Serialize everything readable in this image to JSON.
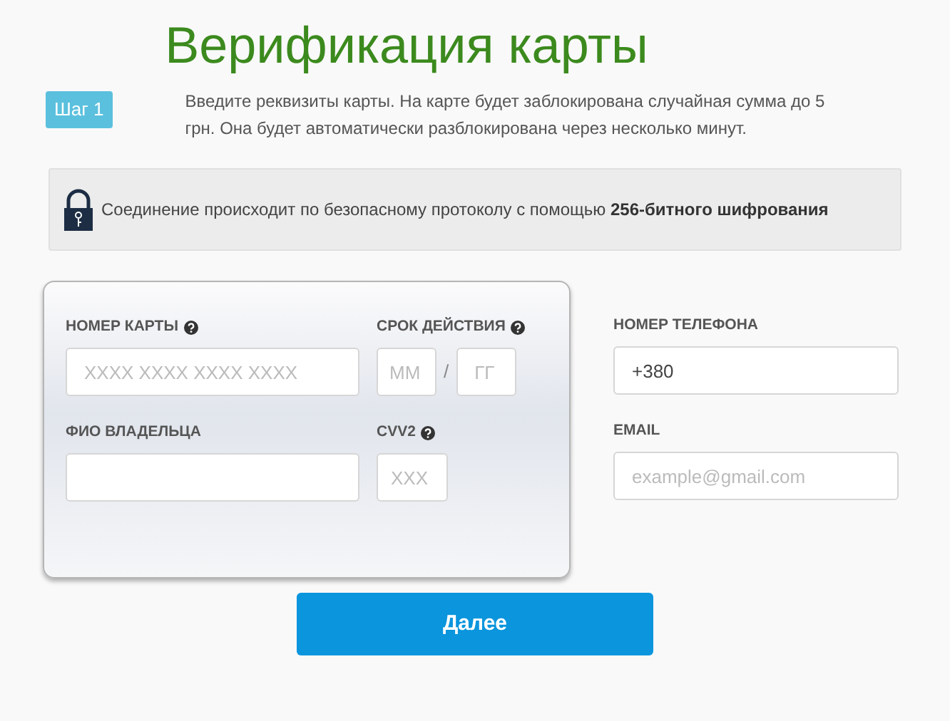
{
  "title": "Верификация карты",
  "step": {
    "badge": "Шаг 1",
    "text": "Введите реквизиты карты. На карте будет заблокирована случайная сумма до 5 грн. Она будет автоматически разблокирована через несколько минут."
  },
  "security_notice": "Соединение происходит по безопасному протоколу с помощью **256-битного шифрования**",
  "card_form": {
    "card_number": {
      "label": "НОМЕР КАРТЫ",
      "help": true,
      "placeholder": "XXXX XXXX XXXX XXXX"
    },
    "expiry": {
      "label": "СРОК ДЕЙСТВИЯ",
      "help": true,
      "month_placeholder": "ММ",
      "separator": "/",
      "year_placeholder": "ГГ"
    },
    "holder_name": {
      "label": "ФИО ВЛАДЕЛЬЦА",
      "help": false
    },
    "cvv": {
      "label": "CVV2",
      "help": true,
      "placeholder": "XXX"
    }
  },
  "contact_form": [
    {
      "label": "НОМЕР ТЕЛЕФОНА",
      "value": "+380"
    },
    {
      "label": "EMAIL",
      "placeholder": "example@gmail.com"
    }
  ],
  "submit_button": "Далее"
}
